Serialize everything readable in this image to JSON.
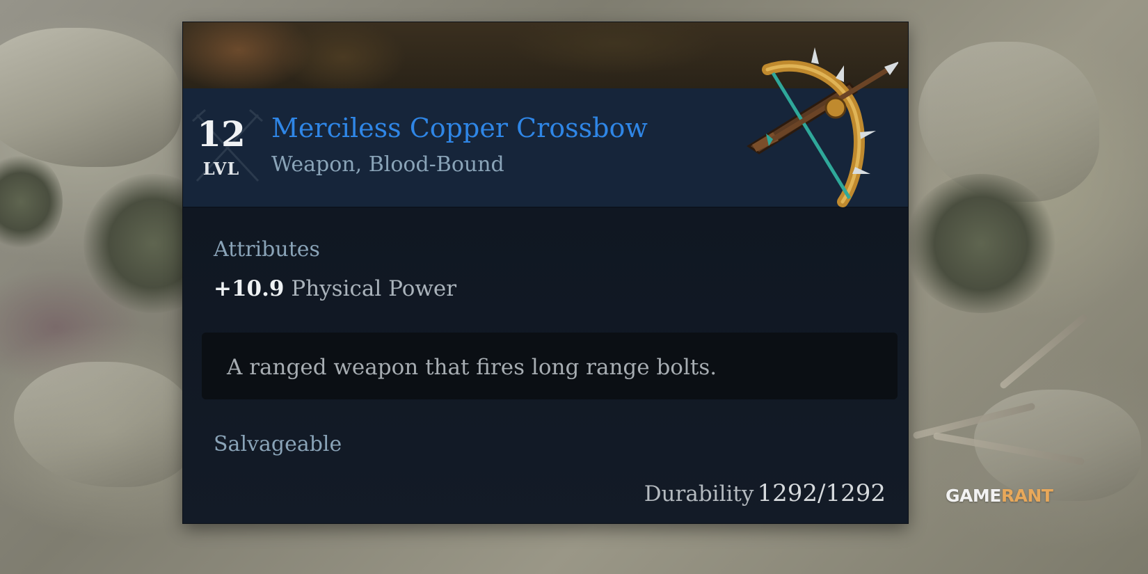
{
  "item": {
    "level": "12",
    "level_label": "LVL",
    "name": "Merciless Copper Crossbow",
    "type": "Weapon, Blood-Bound",
    "name_color": "#2f86e6",
    "icon": "copper-crossbow-icon"
  },
  "attributes": {
    "heading": "Attributes",
    "stats": [
      {
        "value": "+10.9",
        "name": "Physical Power"
      }
    ]
  },
  "description": "A ranged weapon that fires long range bolts.",
  "salvage_label": "Salvageable",
  "durability": {
    "label": "Durability",
    "value": "1292/1292"
  },
  "watermark": {
    "text_main": "GAME",
    "text_accent": "RANT"
  }
}
